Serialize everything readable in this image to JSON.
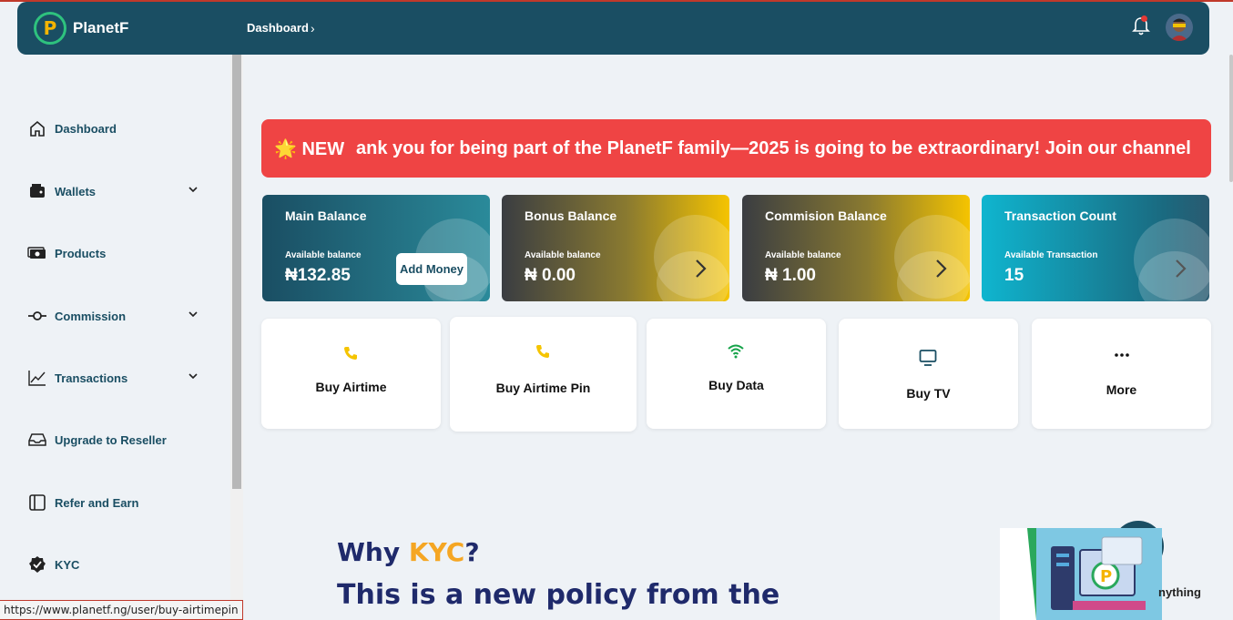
{
  "header": {
    "brand": "PlanetF",
    "logo_letter": "P",
    "breadcrumb": "Dashboard",
    "breadcrumb_chevron": "›"
  },
  "sidebar": {
    "items": [
      {
        "label": "Dashboard",
        "icon": "home-icon",
        "expandable": false
      },
      {
        "label": "Wallets",
        "icon": "wallet-icon",
        "expandable": true
      },
      {
        "label": "Products",
        "icon": "money-icon",
        "expandable": false
      },
      {
        "label": "Commission",
        "icon": "commit-icon",
        "expandable": true
      },
      {
        "label": "Transactions",
        "icon": "chart-line-icon",
        "expandable": true
      },
      {
        "label": "Upgrade to Reseller",
        "icon": "inbox-icon",
        "expandable": false
      },
      {
        "label": "Refer and Earn",
        "icon": "layout-icon",
        "expandable": false
      },
      {
        "label": "KYC",
        "icon": "verified-badge-icon",
        "expandable": false
      }
    ]
  },
  "ticker": {
    "badge": "🌟 NEW",
    "text": "ank you for being part of the PlanetF family—2025 is going to be extraordinary! Join our channel"
  },
  "cards": [
    {
      "title": "Main Balance",
      "subtitle": "Available balance",
      "value": "₦132.85",
      "action": "Add Money"
    },
    {
      "title": "Bonus Balance",
      "subtitle": "Available balance",
      "value": "₦ 0.00"
    },
    {
      "title": "Commision Balance",
      "subtitle": "Available balance",
      "value": "₦ 1.00"
    },
    {
      "title": "Transaction Count",
      "subtitle": "Available Transaction",
      "value": "15"
    }
  ],
  "services": [
    {
      "label": "Buy Airtime",
      "icon": "phone-icon",
      "color": "#f5c400"
    },
    {
      "label": "Buy Airtime Pin",
      "icon": "phone-icon",
      "color": "#f5c400"
    },
    {
      "label": "Buy Data",
      "icon": "wifi-icon",
      "color": "#16a34a"
    },
    {
      "label": "Buy TV",
      "icon": "tv-icon",
      "color": "#1a4e63"
    },
    {
      "label": "More",
      "icon": "more-icon",
      "color": "#111111"
    }
  ],
  "kyc": {
    "q_prefix": "Why ",
    "q_accent": "KYC",
    "q_suffix": "?",
    "paragraph": "This is a new policy from the",
    "chat_text": "nything"
  },
  "status_url": "https://www.planetf.ng/user/buy-airtimepin",
  "colors": {
    "primary": "#1a4e63",
    "ticker": "#ef4444",
    "accent_yellow": "#f5c400",
    "kyc_accent": "#f5a623"
  }
}
